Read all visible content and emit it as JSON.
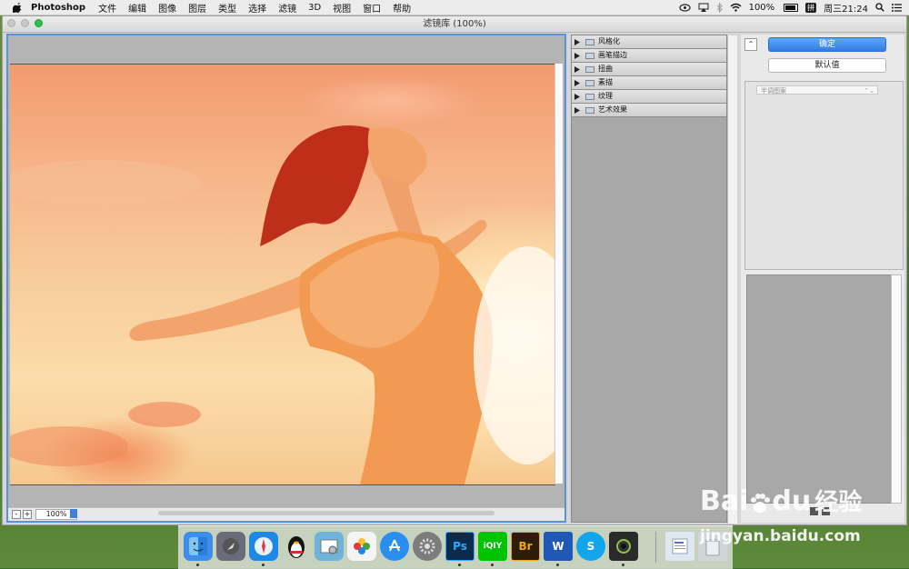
{
  "menubar": {
    "app_name": "Photoshop",
    "items": [
      "文件",
      "编辑",
      "图像",
      "图层",
      "类型",
      "选择",
      "滤镜",
      "3D",
      "视图",
      "窗口",
      "帮助"
    ],
    "battery": "100%",
    "ime": "拼",
    "clock": "周三21:24"
  },
  "window": {
    "title": "滤镜库 (100%)"
  },
  "preview": {
    "zoom_minus": "-",
    "zoom_plus": "+",
    "zoom_value": "100%"
  },
  "filters": {
    "categories": [
      "风格化",
      "画笔描边",
      "扭曲",
      "素描",
      "纹理",
      "艺术效果"
    ]
  },
  "panel": {
    "collapse": "⌃",
    "ok_label": "确定",
    "default_label": "默认值",
    "effect_select": "半调图案"
  },
  "dock": {
    "apps": [
      {
        "name": "Finder",
        "icon": "finder-icon",
        "color": "#3d8ee8"
      },
      {
        "name": "Launchpad",
        "icon": "rocket-icon",
        "color": "#6b6b7a"
      },
      {
        "name": "Safari",
        "icon": "compass-icon",
        "color": "#1e88e5"
      },
      {
        "name": "QQ",
        "icon": "penguin-icon",
        "color": "#222222"
      },
      {
        "name": "Preview",
        "icon": "photos-preview-icon",
        "color": "#6db4d8"
      },
      {
        "name": "Photos",
        "icon": "flower-icon",
        "color": "#f4f4f4"
      },
      {
        "name": "App Store",
        "icon": "appstore-icon",
        "color": "#2a8df0"
      },
      {
        "name": "System Preferences",
        "icon": "gear-icon",
        "color": "#7c7c7c"
      },
      {
        "name": "Ps",
        "icon": "photoshop-icon",
        "color": "#0c2a4a"
      },
      {
        "name": "iQIYI",
        "icon": "iqiyi-icon",
        "color": "#00c400"
      },
      {
        "name": "Br",
        "icon": "bridge-icon",
        "color": "#2b1d07"
      },
      {
        "name": "Word",
        "icon": "word-icon",
        "color": "#1f58b5"
      },
      {
        "name": "Skype",
        "icon": "skype-icon",
        "color": "#11a5ec"
      },
      {
        "name": "Photo Booth",
        "icon": "camera-icon",
        "color": "#2a2a2a"
      },
      {
        "name": "Documents",
        "icon": "document-icon",
        "color": "#dfe7f0"
      },
      {
        "name": "Trash",
        "icon": "trash-icon",
        "color": "#cfd5d8"
      }
    ],
    "labels": {
      "ps": "Ps",
      "br": "Br",
      "word": "W",
      "skype": "S",
      "iqiyi": "iQIY"
    }
  },
  "watermark": {
    "brand": "Bai",
    "brand2": "du",
    "cn": "经验",
    "url": "jingyan.baidu.com"
  },
  "colors": {
    "accent": "#2f7de6",
    "focus_border": "#5a92d8",
    "gray_bg": "#a8a8a8"
  }
}
